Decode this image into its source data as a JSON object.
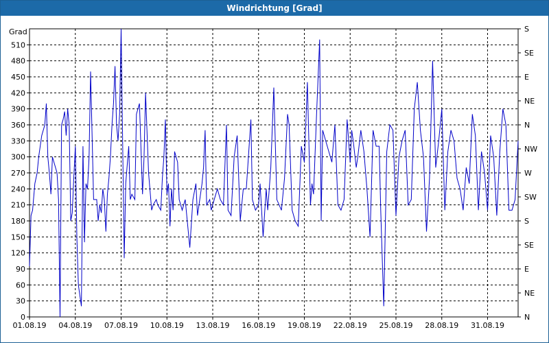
{
  "window": {
    "title": "Windrichtung [Grad]"
  },
  "chart_data": {
    "type": "line",
    "title": "Windrichtung [Grad]",
    "ylabel": "Grad",
    "ylim": [
      0,
      540
    ],
    "grid": true,
    "x_tick_labels": [
      "01.08.19",
      "04.08.19",
      "07.08.19",
      "10.08.19",
      "13.08.19",
      "16.08.19",
      "19.08.19",
      "22.08.19",
      "25.08.19",
      "28.08.19",
      "31.08.19"
    ],
    "y_ticks": [
      0,
      30,
      60,
      90,
      120,
      150,
      180,
      210,
      240,
      270,
      300,
      330,
      360,
      390,
      420,
      450,
      480,
      510
    ],
    "right_ticks": [
      {
        "value": 0,
        "label": "N"
      },
      {
        "value": 45,
        "label": "NE"
      },
      {
        "value": 90,
        "label": "E"
      },
      {
        "value": 135,
        "label": "SE"
      },
      {
        "value": 180,
        "label": "S"
      },
      {
        "value": 225,
        "label": "SW"
      },
      {
        "value": 270,
        "label": "W"
      },
      {
        "value": 315,
        "label": "NW"
      },
      {
        "value": 360,
        "label": "N"
      },
      {
        "value": 405,
        "label": "NE"
      },
      {
        "value": 450,
        "label": "E"
      },
      {
        "value": 495,
        "label": "SE"
      },
      {
        "value": 540,
        "label": "S"
      }
    ],
    "line_color": "#0000c8",
    "series": [
      {
        "x_unit": "days since 01.08.19",
        "x": [
          0,
          0.1,
          0.2,
          0.35,
          0.5,
          0.6,
          0.8,
          1.0,
          1.1,
          1.2,
          1.3,
          1.4,
          1.5,
          1.6,
          1.8,
          1.9,
          2.0,
          2.1,
          2.2,
          2.3,
          2.4,
          2.5,
          2.6,
          2.7,
          2.8,
          2.9,
          3.0,
          3.1,
          3.2,
          3.4,
          3.5,
          3.6,
          3.7,
          3.8,
          3.9,
          4.0,
          4.2,
          4.4,
          4.5,
          4.6,
          4.7,
          4.8,
          4.9,
          5.0,
          5.1,
          5.2,
          5.3,
          5.4,
          5.5,
          5.6,
          5.7,
          5.8,
          5.9,
          6.0,
          6.2,
          6.3,
          6.5,
          6.6,
          6.7,
          6.9,
          7.0,
          7.2,
          7.4,
          7.5,
          7.6,
          7.8,
          8.0,
          8.1,
          8.3,
          8.4,
          8.6,
          8.7,
          8.8,
          8.9,
          9.0,
          9.1,
          9.2,
          9.3,
          9.4,
          9.5,
          9.7,
          9.8,
          10.0,
          10.2,
          10.5,
          10.7,
          10.9,
          11.0,
          11.2,
          11.3,
          11.4,
          11.5,
          11.6,
          11.8,
          11.9,
          12.1,
          12.3,
          12.5,
          12.7,
          12.9,
          13.0,
          13.2,
          13.4,
          13.6,
          13.8,
          14.0,
          14.2,
          14.5,
          14.6,
          14.8,
          15.0,
          15.1,
          15.3,
          15.5,
          15.6,
          15.8,
          16.0,
          16.2,
          16.5,
          16.7,
          16.9,
          17.0,
          17.2,
          17.4,
          17.6,
          17.8,
          18.0,
          18.2,
          18.4,
          18.5,
          18.6,
          18.8,
          19.0,
          19.1,
          19.2,
          19.4,
          19.6,
          19.8,
          20.0,
          20.2,
          20.4,
          20.6,
          20.8,
          21.0,
          21.1,
          21.2,
          21.4,
          21.5,
          21.7,
          21.9,
          22.1,
          22.3,
          22.5,
          22.7,
          22.9,
          23.0,
          23.2,
          23.4,
          23.6,
          23.8,
          24.0,
          24.2,
          24.4,
          24.6,
          24.8,
          25.0,
          25.2,
          25.4,
          25.6,
          25.8,
          26.0,
          26.2,
          26.4,
          26.6,
          26.8,
          27.0,
          27.2,
          27.4,
          27.6,
          27.8,
          28.0,
          28.2,
          28.4,
          28.6,
          28.8,
          29.0,
          29.2,
          29.4,
          29.6,
          29.8,
          30.0,
          30.2,
          30.4,
          30.6,
          30.8,
          31.0,
          31.2,
          31.4,
          31.6,
          31.8,
          32.0
        ],
        "values": [
          95,
          190,
          200,
          250,
          270,
          300,
          340,
          360,
          400,
          300,
          270,
          230,
          300,
          290,
          270,
          220,
          0,
          360,
          370,
          385,
          340,
          390,
          360,
          180,
          195,
          260,
          320,
          150,
          60,
          20,
          320,
          140,
          250,
          240,
          300,
          460,
          220,
          220,
          180,
          210,
          195,
          240,
          220,
          160,
          230,
          260,
          300,
          360,
          400,
          470,
          360,
          330,
          380,
          540,
          110,
          250,
          320,
          220,
          230,
          220,
          380,
          400,
          230,
          300,
          420,
          270,
          200,
          210,
          220,
          210,
          200,
          260,
          300,
          370,
          230,
          250,
          170,
          240,
          200,
          310,
          290,
          220,
          200,
          220,
          130,
          220,
          250,
          190,
          230,
          250,
          280,
          350,
          210,
          220,
          200,
          220,
          240,
          220,
          210,
          360,
          200,
          190,
          300,
          340,
          180,
          240,
          240,
          370,
          220,
          200,
          210,
          250,
          150,
          240,
          200,
          280,
          430,
          220,
          200,
          260,
          380,
          360,
          200,
          180,
          170,
          320,
          290,
          440,
          210,
          250,
          230,
          380,
          520,
          180,
          350,
          330,
          310,
          290,
          360,
          210,
          200,
          220,
          370,
          290,
          350,
          330,
          280,
          300,
          350,
          310,
          240,
          150,
          350,
          320,
          320,
          200,
          20,
          310,
          360,
          350,
          190,
          300,
          330,
          350,
          210,
          220,
          390,
          440,
          350,
          300,
          160,
          260,
          480,
          280,
          330,
          390,
          200,
          310,
          350,
          330,
          260,
          240,
          200,
          280,
          250,
          380,
          340,
          200,
          310,
          270,
          200,
          340,
          300,
          190,
          310,
          390,
          360,
          200,
          200,
          220,
          330
        ]
      }
    ]
  }
}
